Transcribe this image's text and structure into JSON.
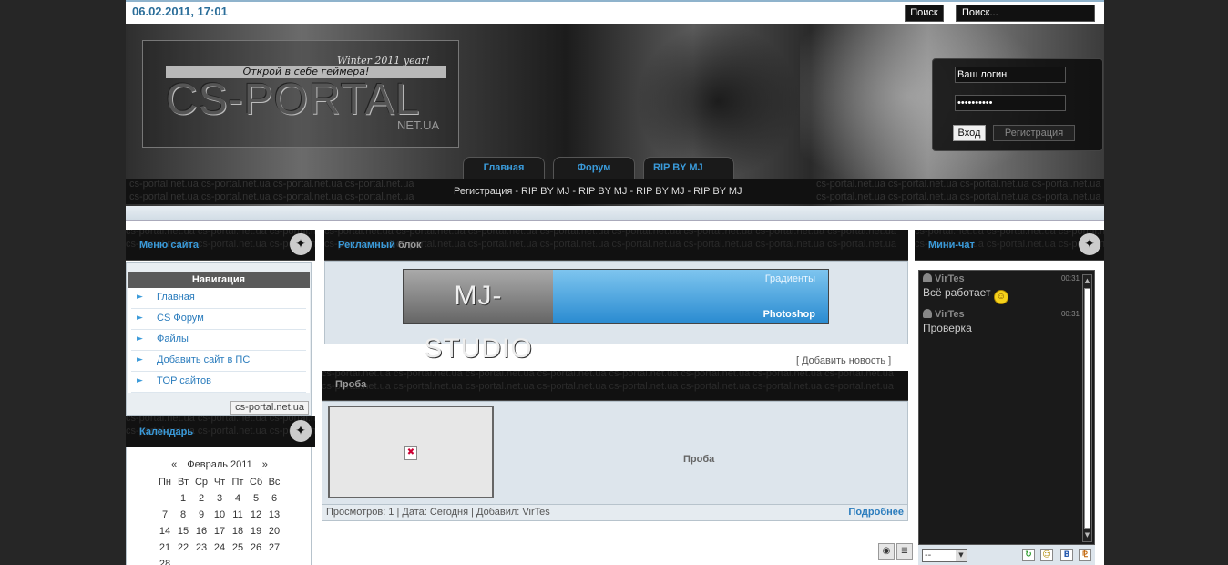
{
  "topbar": {
    "datetime": "06.02.2011, 17:01",
    "search_button": "Поиск",
    "search_value": "Поиск..."
  },
  "header": {
    "tagline_top": "Winter 2011 year!",
    "tagline": "Открой в себе геймера!",
    "logo": "CS-PORTAL",
    "logo_sub": "NET.UA",
    "login_value": "Ваш логин",
    "password_value": "••••••••••",
    "login_button": "Вход",
    "register_button": "Регистрация",
    "tabs": [
      "Главная",
      "Форум",
      "RIP BY MJ"
    ],
    "subnav": [
      "Регистрация",
      "RIP BY MJ",
      "RIP BY MJ",
      "RIP BY MJ",
      "RIP BY MJ"
    ],
    "subnav_sep": "-",
    "watermark": "cs-portal.net.ua cs-portal.net.ua cs-portal.net.ua cs-portal.net.ua"
  },
  "left": {
    "menu_title": "Меню сайта",
    "nav_heading": "Навигация",
    "nav_items": [
      "Главная",
      "CS Форум",
      "Файлы",
      "Добавить сайт в ПС",
      "TOP сайтов"
    ],
    "footer_tag": "cs-portal.net.ua",
    "calendar_title": "Календарь",
    "calendar": {
      "prev": "«",
      "next": "»",
      "month": "Февраль 2011",
      "weekdays": [
        "Пн",
        "Вт",
        "Ср",
        "Чт",
        "Пт",
        "Сб",
        "Вс"
      ],
      "rows": [
        [
          "",
          "1",
          "2",
          "3",
          "4",
          "5",
          "6"
        ],
        [
          "7",
          "8",
          "9",
          "10",
          "11",
          "12",
          "13"
        ],
        [
          "14",
          "15",
          "16",
          "17",
          "18",
          "19",
          "20"
        ],
        [
          "21",
          "22",
          "23",
          "24",
          "25",
          "26",
          "27"
        ],
        [
          "28",
          "",
          "",
          "",
          "",
          "",
          ""
        ]
      ]
    }
  },
  "center": {
    "ad_title_a": "Рекламный",
    "ad_title_b": "блок",
    "banner_left": "MJ-STUDIO",
    "banner_top": "Градиенты",
    "banner_bottom": "Photoshop",
    "add_news": "[ Добавить новость ]",
    "news_title": "Проба",
    "news_text": "Проба",
    "news_meta": "Просмотров: 1 | Дата: Сегодня | Добавил: VirTes",
    "news_more": "Подробнее",
    "watermark": "cs-portal.net.ua cs-portal.net.ua cs-portal.net.ua cs-portal.net.ua cs-portal.net.ua cs-portal.net.ua cs-portal.net.ua cs-portal.net.ua"
  },
  "right": {
    "chat_title": "Мини-чат",
    "messages": [
      {
        "user": "VirTes",
        "time": "00:31",
        "text": "Всё работает"
      },
      {
        "user": "VirTes",
        "time": "00:31",
        "text": "Проверка"
      }
    ],
    "select_value": "--",
    "buttons": [
      "↻",
      "☺",
      "B",
      "⅊"
    ]
  },
  "colors": {
    "accent": "#3a9ad9",
    "link": "#2a7cbd",
    "dark": "#111111",
    "panel": "#dde5ec"
  }
}
